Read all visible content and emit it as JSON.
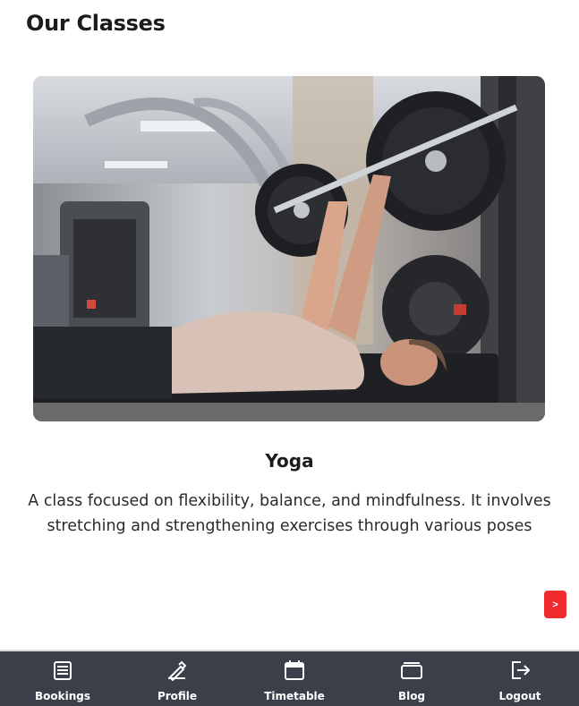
{
  "page": {
    "title": "Our Classes"
  },
  "class_card": {
    "name": "Yoga",
    "description": "A class focused on flexibility, balance, and mindfulness. It involves stretching and strengthening exercises through various poses",
    "next_label": ">"
  },
  "nav": {
    "items": [
      {
        "label": "Bookings",
        "icon": "list-icon"
      },
      {
        "label": "Profile",
        "icon": "pencil-icon"
      },
      {
        "label": "Timetable",
        "icon": "calendar-icon"
      },
      {
        "label": "Blog",
        "icon": "folder-icon"
      },
      {
        "label": "Logout",
        "icon": "logout-icon"
      }
    ]
  },
  "colors": {
    "accent": "#ef2b2d",
    "nav_background": "#3a3f4a",
    "nav_text": "#ffffff"
  }
}
